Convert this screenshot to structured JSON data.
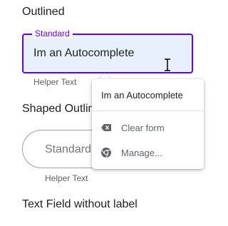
{
  "sections": {
    "outlined_title": "Outlined",
    "shaped_title": "Shaped Outlined",
    "nolabel_title": "Text Field without label"
  },
  "outlined_field": {
    "label": "Standard",
    "value": "Im an Autocomplete",
    "helper": "Helper Text"
  },
  "shaped_field": {
    "placeholder": "Standard",
    "helper": "Helper Text"
  },
  "autocomplete": {
    "suggestion": "Im an Autocomplete",
    "actions": [
      {
        "label": "Clear form",
        "icon": "backspace-icon"
      },
      {
        "label": "Manage...",
        "icon": "chrome-icon"
      }
    ]
  },
  "colors": {
    "primary": "#6200ee",
    "autofill_bg": "#e8f0fe"
  }
}
